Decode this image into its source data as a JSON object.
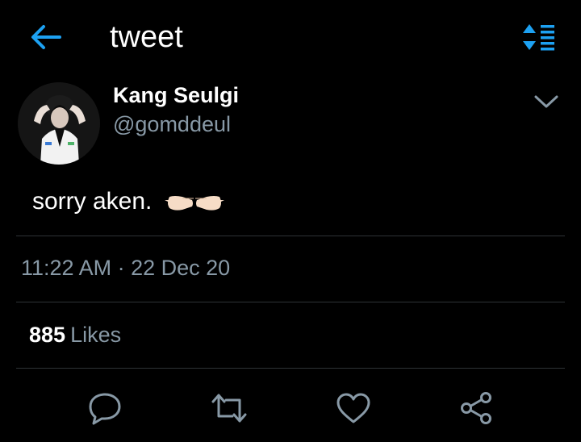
{
  "header": {
    "title": "tweet",
    "back_icon": "arrow-left-icon",
    "sort_icon": "sort-lines-icon",
    "accent_color": "#1da1f2"
  },
  "author": {
    "display_name": "Kang Seulgi",
    "handle": "@gomddeul",
    "avatar_icon": "profile-photo"
  },
  "tweet": {
    "text": "sorry aken.",
    "emoji": "👉👈"
  },
  "meta": {
    "time": "11:22 AM",
    "separator": "·",
    "date": "22 Dec 20"
  },
  "stats": {
    "likes_count": "885",
    "likes_label": "Likes"
  },
  "actions": [
    {
      "name": "reply",
      "icon": "reply-icon"
    },
    {
      "name": "retweet",
      "icon": "retweet-icon"
    },
    {
      "name": "like",
      "icon": "heart-icon"
    },
    {
      "name": "share",
      "icon": "share-icon"
    }
  ],
  "colors": {
    "background": "#000000",
    "primary_text": "#ffffff",
    "secondary_text": "#8899a6",
    "divider": "#2f3336",
    "icon": "#8899a6"
  }
}
